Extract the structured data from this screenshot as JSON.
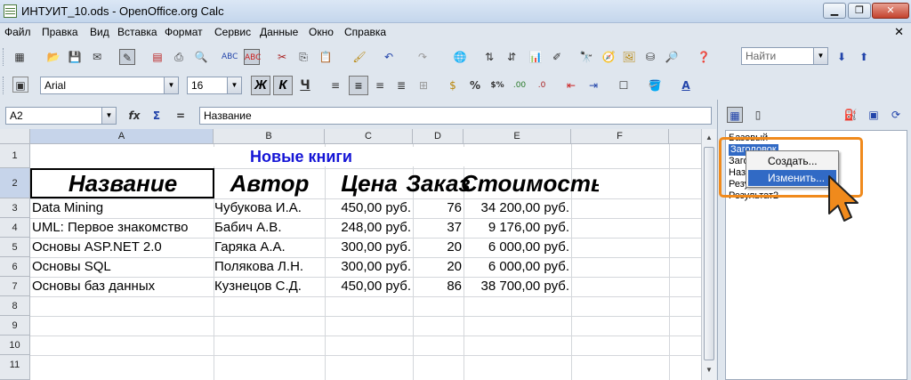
{
  "window": {
    "title": "ИНТУИТ_10.ods - OpenOffice.org Calc"
  },
  "menu": [
    "Файл",
    "Правка",
    "Вид",
    "Вставка",
    "Формат",
    "Сервис",
    "Данные",
    "Окно",
    "Справка"
  ],
  "toolbar": {
    "find_placeholder": "Найти"
  },
  "format": {
    "font_name": "Arial",
    "font_size": "16",
    "bold": "Ж",
    "italic": "К",
    "underline": "Ч"
  },
  "formula_bar": {
    "cell_ref": "A2",
    "content": "Название"
  },
  "sheet": {
    "columns": [
      "A",
      "B",
      "C",
      "D",
      "E",
      "F"
    ],
    "rows": [
      "1",
      "2",
      "3",
      "4",
      "5",
      "6",
      "7",
      "8",
      "9",
      "10",
      "11"
    ],
    "title": "Новые книги",
    "headers": [
      "Название",
      "Автор",
      "Цена",
      "Заказ",
      "Стоимость"
    ],
    "data": [
      [
        "Data Mining",
        "Чубукова И.А.",
        "450,00 руб.",
        "76",
        "34 200,00 руб."
      ],
      [
        "UML: Первое знакомство",
        "Бабич А.В.",
        "248,00 руб.",
        "37",
        "9 176,00 руб."
      ],
      [
        "Основы ASP.NET 2.0",
        "Гаряка А.А.",
        "300,00 руб.",
        "20",
        "6 000,00 руб."
      ],
      [
        "Основы SQL",
        "Полякова Л.Н.",
        "300,00 руб.",
        "20",
        "6 000,00 руб."
      ],
      [
        "Основы баз данных",
        "Кузнецов С.Д.",
        "450,00 руб.",
        "86",
        "38 700,00 руб."
      ]
    ]
  },
  "styles_panel": {
    "items": [
      "Базовый",
      "Заголовок",
      "Заголовок1",
      "Название",
      "Результат",
      "Результат2"
    ]
  },
  "context_menu": {
    "items": [
      "Создать...",
      "Изменить..."
    ]
  },
  "colors": {
    "accent_orange": "#f08a1c",
    "selection": "#316ac5",
    "title_blue": "#1515d6"
  }
}
